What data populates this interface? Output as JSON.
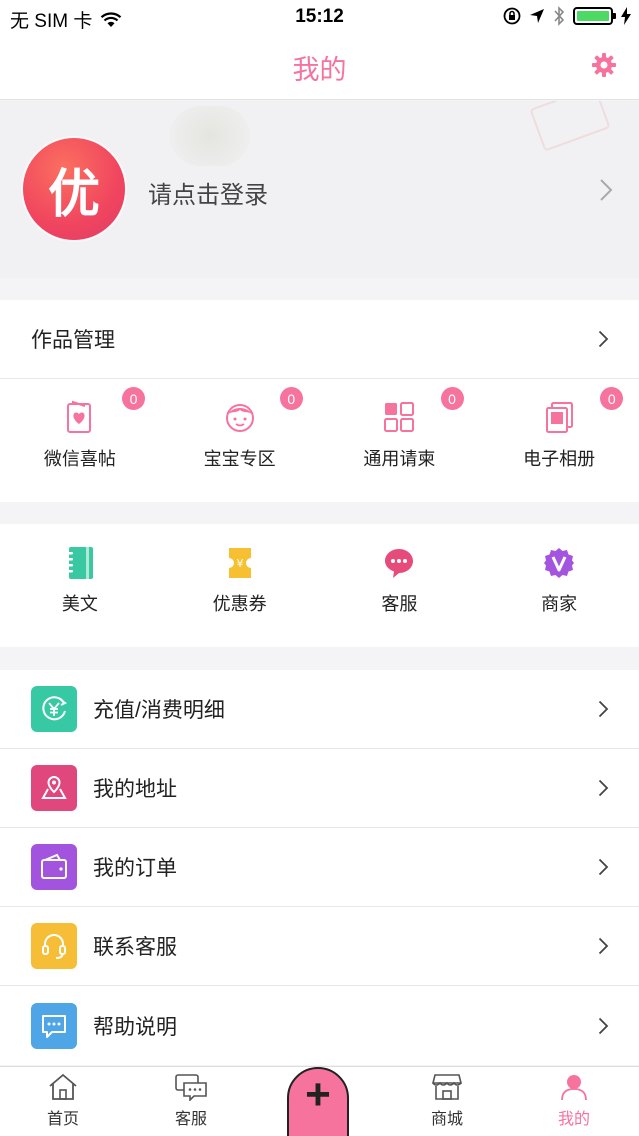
{
  "status_bar": {
    "carrier": "无 SIM 卡",
    "time": "15:12"
  },
  "nav": {
    "title": "我的"
  },
  "profile": {
    "avatar_text": "优",
    "login_text": "请点击登录"
  },
  "works": {
    "title": "作品管理",
    "items": [
      {
        "label": "微信喜帖",
        "count": "0",
        "icon": "invitation-card-icon"
      },
      {
        "label": "宝宝专区",
        "count": "0",
        "icon": "baby-face-icon"
      },
      {
        "label": "通用请柬",
        "count": "0",
        "icon": "grid-icon"
      },
      {
        "label": "电子相册",
        "count": "0",
        "icon": "photo-album-icon"
      }
    ]
  },
  "features": [
    {
      "label": "美文",
      "icon": "notebook-icon",
      "color": "#3ac8a3"
    },
    {
      "label": "优惠券",
      "icon": "coupon-icon",
      "color": "#f7c033"
    },
    {
      "label": "客服",
      "icon": "chat-bubble-icon",
      "color": "#e64b7b"
    },
    {
      "label": "商家",
      "icon": "vip-badge-icon",
      "color": "#a455e0"
    }
  ],
  "menu": [
    {
      "label": "充值/消费明细",
      "icon": "yen-circle-icon",
      "color": "#37c9a4"
    },
    {
      "label": "我的地址",
      "icon": "location-map-icon",
      "color": "#e0487d"
    },
    {
      "label": "我的订单",
      "icon": "wallet-icon",
      "color": "#a254de"
    },
    {
      "label": "联系客服",
      "icon": "headset-icon",
      "color": "#f6bd36"
    },
    {
      "label": "帮助说明",
      "icon": "message-icon",
      "color": "#4ea6e6"
    }
  ],
  "tabbar": {
    "items": [
      {
        "label": "首页",
        "icon": "home-icon"
      },
      {
        "label": "客服",
        "icon": "chat-icon"
      },
      {
        "label": "+",
        "icon": "plus-icon"
      },
      {
        "label": "商城",
        "icon": "store-icon"
      },
      {
        "label": "我的",
        "icon": "user-icon"
      }
    ],
    "active_color": "#f6739e"
  }
}
